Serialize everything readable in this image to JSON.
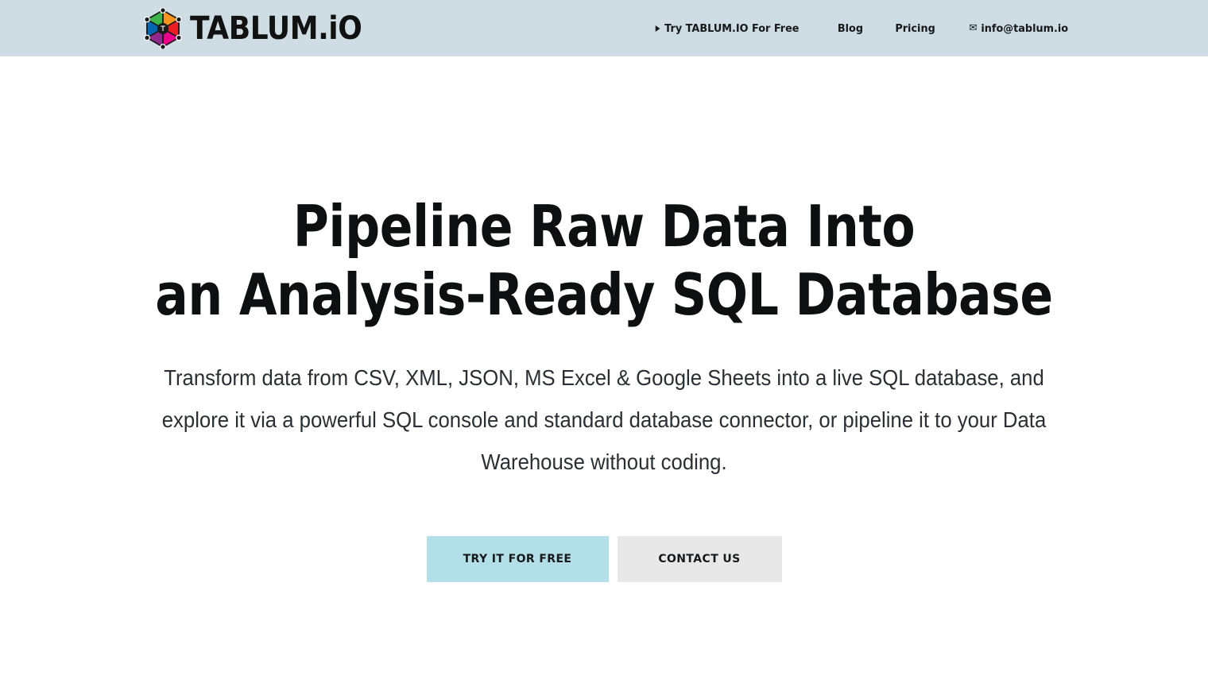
{
  "header": {
    "background_color": "#cedde4",
    "brand": {
      "name": "brand-logo",
      "text": "TABLUM.iO",
      "icon": "hexagon-network-logo",
      "colors": {
        "green": "#3bb54a",
        "orange": "#f7941e",
        "red": "#ed1c24",
        "magenta": "#ec008c",
        "purple": "#92278f",
        "blue": "#0066b3",
        "node": "#1a1a1a"
      }
    },
    "nav": {
      "items": [
        {
          "id": "try-free",
          "label": "Try TABLUM.IO For Free",
          "icon": "play-triangle-icon"
        },
        {
          "id": "blog",
          "label": "Blog",
          "icon": null
        },
        {
          "id": "pricing",
          "label": "Pricing",
          "icon": null
        },
        {
          "id": "email",
          "label": "info@tablum.io",
          "icon": "envelope-icon"
        }
      ]
    }
  },
  "hero": {
    "background_color": "#ffffff",
    "title_line1": "Pipeline Raw Data Into",
    "title_line2": "an Analysis-Ready SQL Database",
    "subtitle": "Transform data from CSV, XML, JSON, MS Excel & Google Sheets into a live SQL database, and explore it via a powerful SQL console and standard database connector, or pipeline it to your Data Warehouse without coding.",
    "cta": {
      "primary": {
        "label": "TRY IT FOR FREE",
        "background_color": "#b3dfe8",
        "text_color": "#16181a"
      },
      "secondary": {
        "label": "CONTACT US",
        "background_color": "#e8e8e8",
        "text_color": "#16181a"
      }
    }
  }
}
